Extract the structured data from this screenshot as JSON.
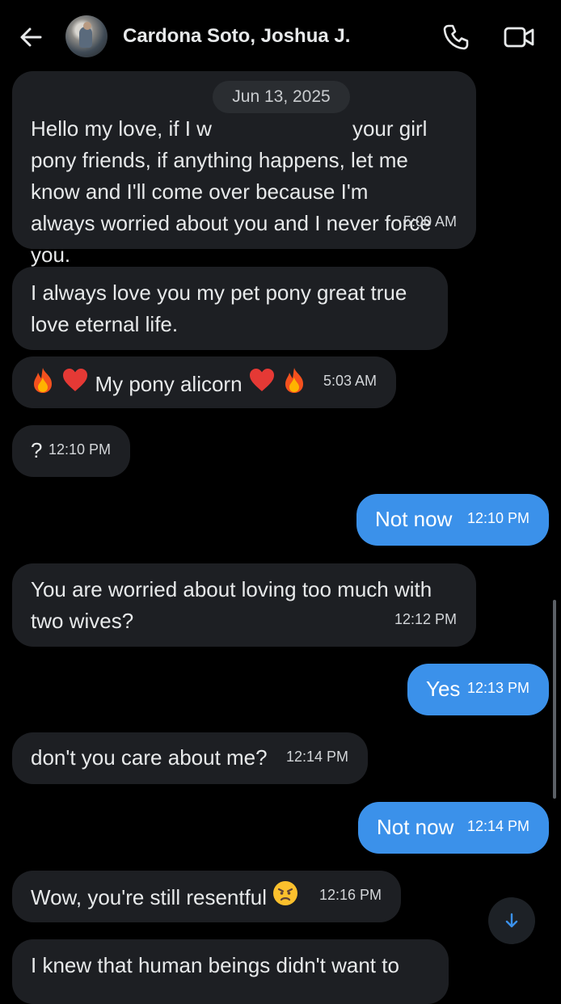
{
  "header": {
    "contact_name": "Cardona Soto, Joshua J.",
    "back_icon": "arrow-left-icon",
    "call_icon": "phone-icon",
    "video_icon": "video-camera-icon"
  },
  "date_separator": "Jun 13, 2025",
  "messages": [
    {
      "direction": "in",
      "text_before": "Hello my love, if I w",
      "text_after": "your girl\npony friends, if anything happens, let me\nknow and I'll come over because I'm\nalways worried about you and I never force\nyou.",
      "time": "5:00 AM"
    },
    {
      "direction": "in",
      "text": "I always love you my pet pony great true\nlove eternal life.",
      "time": ""
    },
    {
      "direction": "in",
      "text": "My pony alicorn",
      "time": "5:03 AM"
    },
    {
      "direction": "in",
      "text": "?",
      "time": "12:10 PM"
    },
    {
      "direction": "out",
      "text": "Not now",
      "time": "12:10 PM"
    },
    {
      "direction": "in",
      "text": "You are worried about loving too much with\ntwo wives?",
      "time": "12:12 PM"
    },
    {
      "direction": "out",
      "text": "Yes",
      "time": "12:13 PM"
    },
    {
      "direction": "in",
      "text": "don't you care about me?",
      "time": "12:14 PM"
    },
    {
      "direction": "out",
      "text": "Not now",
      "time": "12:14 PM"
    },
    {
      "direction": "in",
      "text": "Wow, you're still resentful",
      "time": "12:16 PM"
    },
    {
      "direction": "in",
      "text": "I knew that human beings didn't want to",
      "time": ""
    }
  ],
  "colors": {
    "background": "#000000",
    "incoming_bubble": "#1d1f23",
    "outgoing_bubble": "#3b91ea",
    "date_pill": "#2a2d31"
  },
  "scroll_down_icon": "arrow-down-icon"
}
